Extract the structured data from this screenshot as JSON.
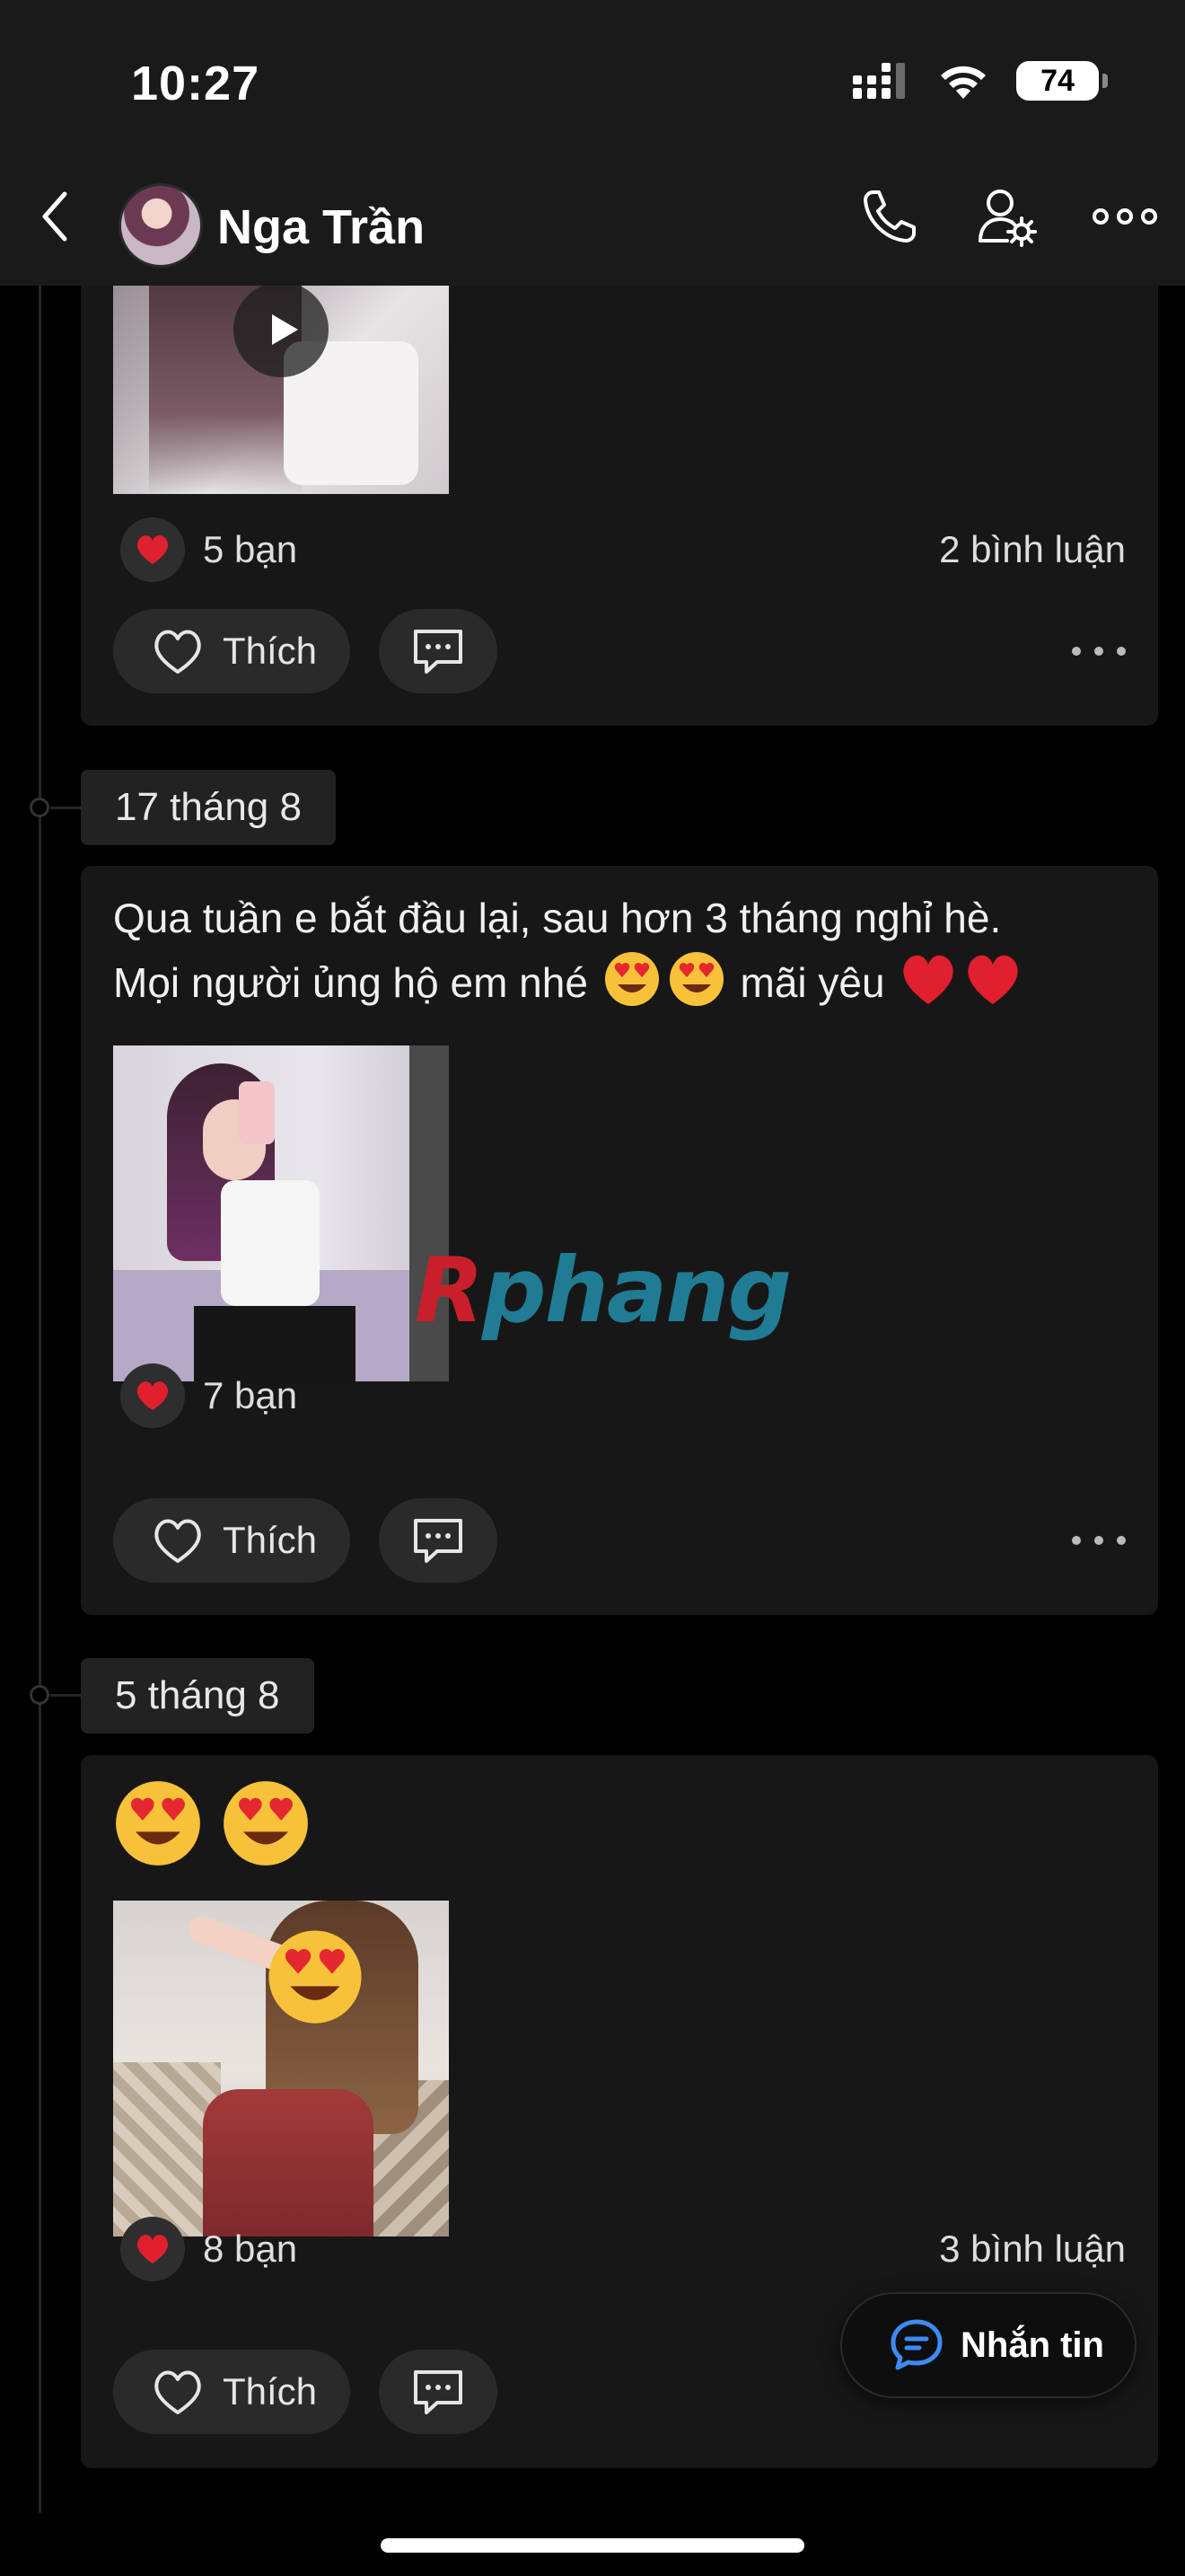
{
  "status_bar": {
    "time": "10:27",
    "battery": "74"
  },
  "header": {
    "contact_name": "Nga Trần"
  },
  "posts": [
    {
      "reactions": "5 bạn",
      "comments": "2 bình luận",
      "like_label": "Thích"
    },
    {
      "date": "17 tháng 8",
      "text_line1": "Qua tuần e bắt đầu lại, sau hơn 3 tháng nghỉ hè.",
      "text_line2_a": "Mọi người ủng hộ em nhé",
      "text_line2_b": "mãi yêu",
      "reactions": "7 bạn",
      "like_label": "Thích"
    },
    {
      "date": "5 tháng 8",
      "reactions": "8 bạn",
      "comments": "3 bình luận",
      "like_label": "Thích"
    }
  ],
  "watermark": {
    "first": "R",
    "rest": "phang"
  },
  "message_button": {
    "label": "Nhắn tin"
  },
  "colors": {
    "background": "#000000",
    "card": "#171717",
    "heart": "#e0202e",
    "accent_blue": "#3d8bf5"
  },
  "icons": [
    "back-chevron-icon",
    "phone-icon",
    "user-settings-icon",
    "more-icon",
    "play-icon",
    "heart-icon",
    "comment-icon",
    "chat-bubble-icon"
  ]
}
